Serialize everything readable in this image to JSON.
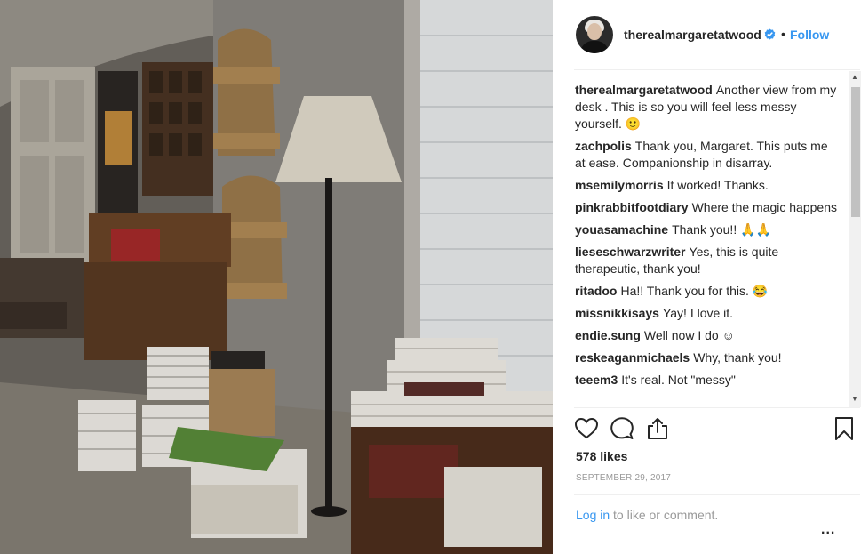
{
  "post": {
    "username": "therealmargaretatwood",
    "separator": "•",
    "follow_label": "Follow",
    "likes": "578 likes",
    "date": "SEPTEMBER 29, 2017",
    "login_link": "Log in",
    "login_suffix": " to like or comment.",
    "more_label": "..."
  },
  "comments": [
    {
      "author": "therealmargaretatwood",
      "text": "Another view from my desk . This is so you will feel less messy yourself. 🙂"
    },
    {
      "author": "zachpolis",
      "text": "Thank you, Margaret. This puts me at ease. Companionship in disarray."
    },
    {
      "author": "msemilymorris",
      "text": "It worked! Thanks."
    },
    {
      "author": "pinkrabbitfootdiary",
      "text": "Where the magic happens"
    },
    {
      "author": "youasamachine",
      "text": "Thank you!! 🙏🙏"
    },
    {
      "author": "lieseschwarzwriter",
      "text": "Yes, this is quite therapeutic, thank you!"
    },
    {
      "author": "ritadoo",
      "text": "Ha!! Thank you for this. 😂"
    },
    {
      "author": "missnikkisays",
      "text": "Yay! I love it."
    },
    {
      "author": "endie.sung",
      "text": "Well now I do ☺"
    },
    {
      "author": "reskeaganmichaels",
      "text": "Why, thank you!"
    },
    {
      "author": "teeem3",
      "text": "It's real. Not \"messy\""
    }
  ],
  "icons": {
    "verified": "verified-badge-icon",
    "like": "heart-icon",
    "comment": "comment-bubble-icon",
    "share": "share-upload-icon",
    "save": "bookmark-icon"
  },
  "colors": {
    "link": "#3897f0",
    "text": "#262626",
    "muted": "#999999"
  }
}
